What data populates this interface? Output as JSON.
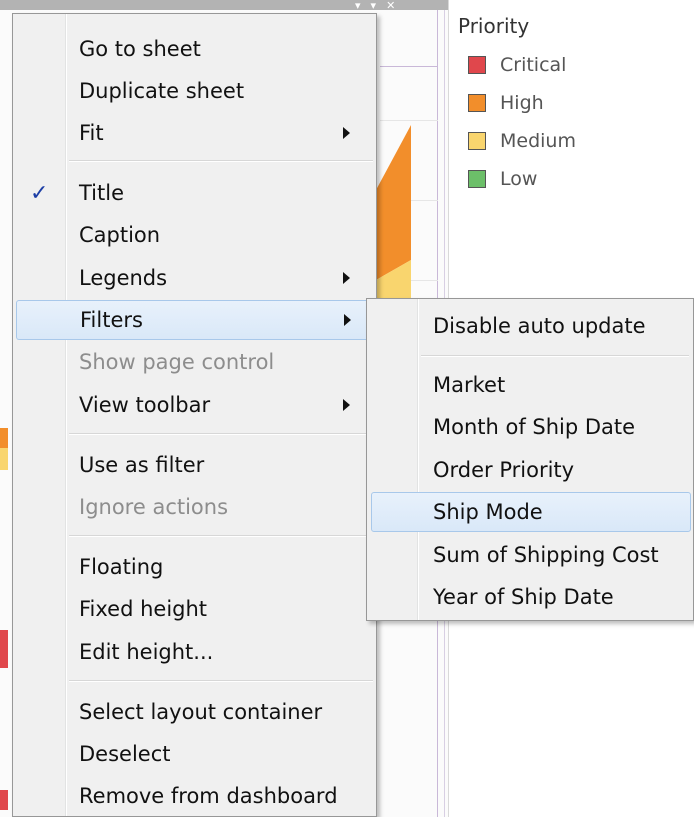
{
  "background": {
    "sheet_controls": [
      "▾",
      "▾",
      "✕"
    ]
  },
  "legend": {
    "title": "Priority",
    "items": [
      {
        "label": "Critical",
        "color": "#e0474c"
      },
      {
        "label": "High",
        "color": "#f28e2b"
      },
      {
        "label": "Medium",
        "color": "#f9d56e"
      },
      {
        "label": "Low",
        "color": "#6cbf69"
      }
    ]
  },
  "context_menu": {
    "items": [
      {
        "label": "Go to sheet"
      },
      {
        "label": "Duplicate sheet"
      },
      {
        "label": "Fit",
        "has_submenu": true
      },
      {
        "label": "Title",
        "checked": true
      },
      {
        "label": "Caption"
      },
      {
        "label": "Legends",
        "has_submenu": true
      },
      {
        "label": "Filters",
        "has_submenu": true,
        "highlighted": true
      },
      {
        "label": "Show page control",
        "disabled": true
      },
      {
        "label": "View toolbar",
        "has_submenu": true
      },
      {
        "label": "Use as filter"
      },
      {
        "label": "Ignore actions",
        "disabled": true
      },
      {
        "label": "Floating"
      },
      {
        "label": "Fixed height"
      },
      {
        "label": "Edit height..."
      },
      {
        "label": "Select layout container"
      },
      {
        "label": "Deselect"
      },
      {
        "label": "Remove from dashboard"
      }
    ],
    "check_glyph": "✓"
  },
  "filters_submenu": {
    "items": [
      {
        "label": "Disable auto update"
      },
      {
        "label": "Market"
      },
      {
        "label": "Month of Ship Date"
      },
      {
        "label": "Order Priority"
      },
      {
        "label": "Ship Mode",
        "highlighted": true
      },
      {
        "label": "Sum of Shipping Cost"
      },
      {
        "label": "Year of Ship Date"
      }
    ]
  }
}
